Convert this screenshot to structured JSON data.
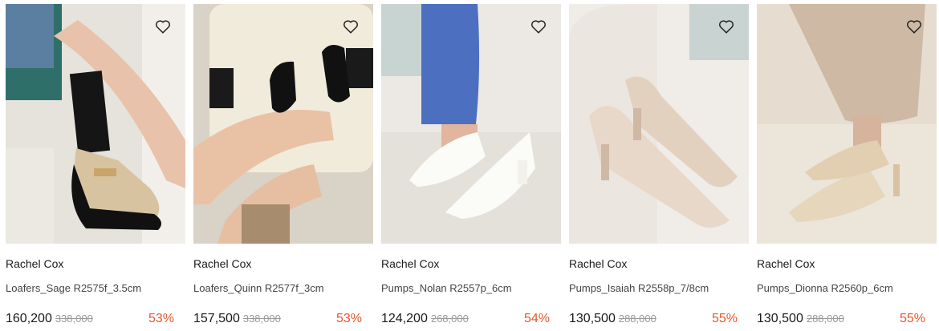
{
  "accent_discount_color": "#e8552c",
  "products": [
    {
      "brand": "Rachel Cox",
      "name": "Loafers_Sage R2575f_3.5cm",
      "price": "160,200",
      "original_price": "338,000",
      "discount": "53%",
      "wishlist_icon": "heart-outline-icon"
    },
    {
      "brand": "Rachel Cox",
      "name": "Loafers_Quinn R2577f_3cm",
      "price": "157,500",
      "original_price": "338,000",
      "discount": "53%",
      "wishlist_icon": "heart-outline-icon"
    },
    {
      "brand": "Rachel Cox",
      "name": "Pumps_Nolan R2557p_6cm",
      "price": "124,200",
      "original_price": "268,000",
      "discount": "54%",
      "wishlist_icon": "heart-outline-icon"
    },
    {
      "brand": "Rachel Cox",
      "name": "Pumps_Isaiah R2558p_7/8cm",
      "price": "130,500",
      "original_price": "288,000",
      "discount": "55%",
      "wishlist_icon": "heart-outline-icon"
    },
    {
      "brand": "Rachel Cox",
      "name": "Pumps_Dionna R2560p_6cm",
      "price": "130,500",
      "original_price": "288,000",
      "discount": "55%",
      "wishlist_icon": "heart-outline-icon"
    }
  ]
}
